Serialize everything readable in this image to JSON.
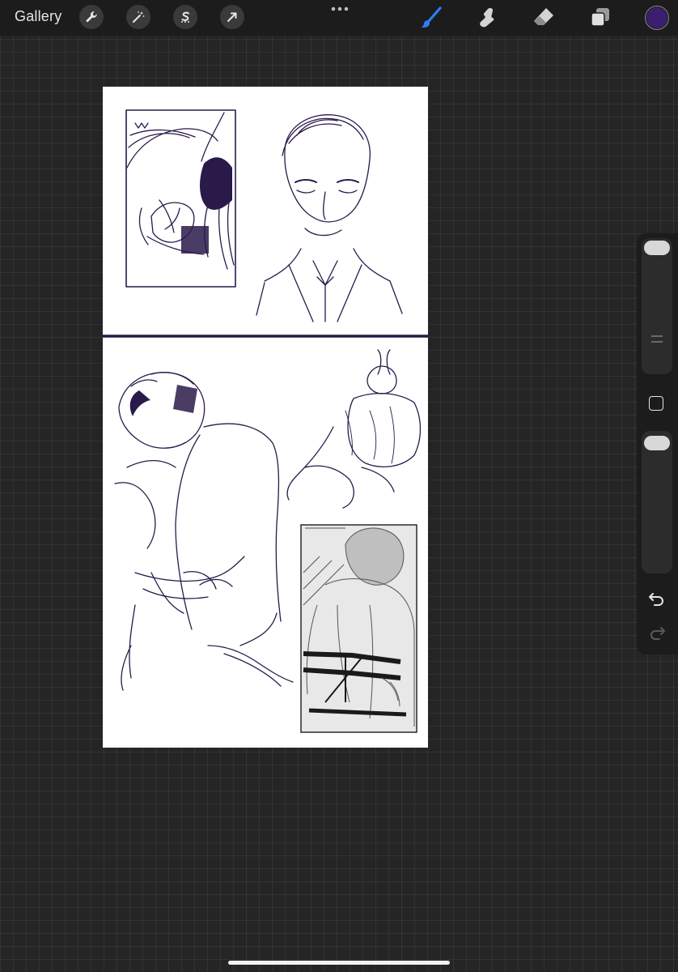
{
  "toolbar": {
    "gallery_label": "Gallery",
    "left_tools": [
      "wrench-icon",
      "magic-wand-icon",
      "selection-s-icon",
      "transform-arrow-icon"
    ],
    "more_icon": "ellipsis-icon",
    "right_tools": [
      "brush-icon",
      "smudge-icon",
      "eraser-icon",
      "layers-icon"
    ],
    "active_tool": "brush",
    "active_color": "#3b1f6e",
    "accent_color": "#2f7df6"
  },
  "sidebar": {
    "top_slider_label": "brush-size-slider",
    "bottom_slider_label": "opacity-slider",
    "undo_icon": "undo-icon",
    "redo_icon": "redo-icon"
  },
  "canvas": {
    "ink_color": "#2a1a4a",
    "description_free": true
  }
}
